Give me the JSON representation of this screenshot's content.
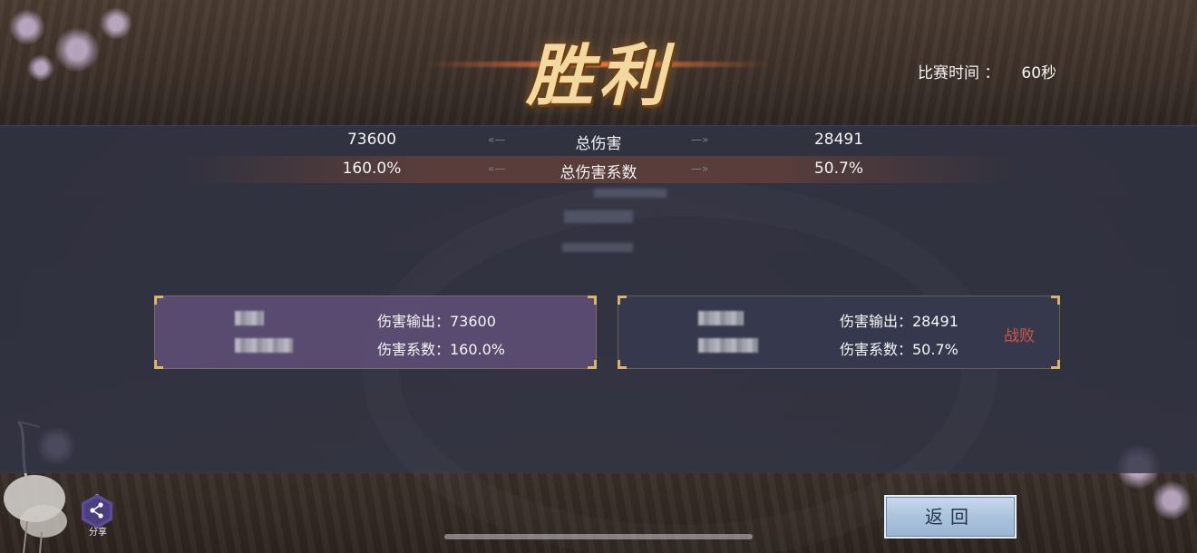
{
  "header": {
    "title": "胜利",
    "match_time_label": "比赛时间 ：",
    "match_time_value": "60秒"
  },
  "summary": {
    "rows": [
      {
        "left": "73600",
        "label": "总伤害",
        "right": "28491"
      },
      {
        "left": "160.0%",
        "label": "总伤害系数",
        "right": "50.7%"
      }
    ]
  },
  "players": {
    "left": {
      "damage_output": "伤害输出：73600",
      "damage_coef": "伤害系数：160.0%"
    },
    "right": {
      "damage_output": "伤害输出：28491",
      "damage_coef": "伤害系数：50.7%",
      "result": "战败"
    }
  },
  "footer": {
    "share_label": "分享",
    "back_label": "返回"
  },
  "icons": {
    "share": "share-icon"
  },
  "colors": {
    "title": "#f3d9a0",
    "defeat": "#d0564a",
    "left_card": "#5f5078",
    "right_card": "#373a4e"
  }
}
